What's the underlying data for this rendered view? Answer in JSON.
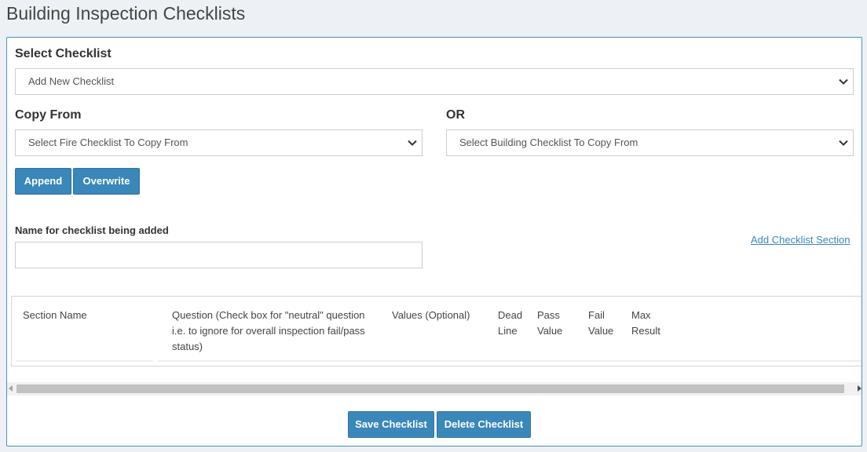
{
  "page": {
    "title": "Building Inspection Checklists"
  },
  "select_checklist": {
    "label": "Select Checklist",
    "value": "Add New Checklist"
  },
  "copy_from": {
    "label": "Copy From",
    "fire_select_value": "Select Fire Checklist To Copy From",
    "or_label": "OR",
    "building_select_value": "Select Building Checklist To Copy From"
  },
  "actions": {
    "append_label": "Append",
    "overwrite_label": "Overwrite"
  },
  "name_field": {
    "label": "Name for checklist being added",
    "value": ""
  },
  "add_section_link": "Add Checklist Section",
  "table": {
    "columns": [
      "Section Name",
      "Question (Check box for \"neutral\" question i.e. to ignore for overall inspection fail/pass status)",
      "Values (Optional)",
      "Dead Line",
      "Pass Value",
      "Fail Value",
      "Max Result"
    ]
  },
  "footer": {
    "save_label": "Save Checklist",
    "delete_label": "Delete Checklist"
  },
  "icons": {
    "select_arrow": "chevron-down-icon",
    "scroll_left": "arrow-left-icon",
    "scroll_right": "arrow-right-icon"
  },
  "colors": {
    "accent": "#3a87ba",
    "panel_border": "#4a8fc0",
    "background": "#edf1f5"
  }
}
